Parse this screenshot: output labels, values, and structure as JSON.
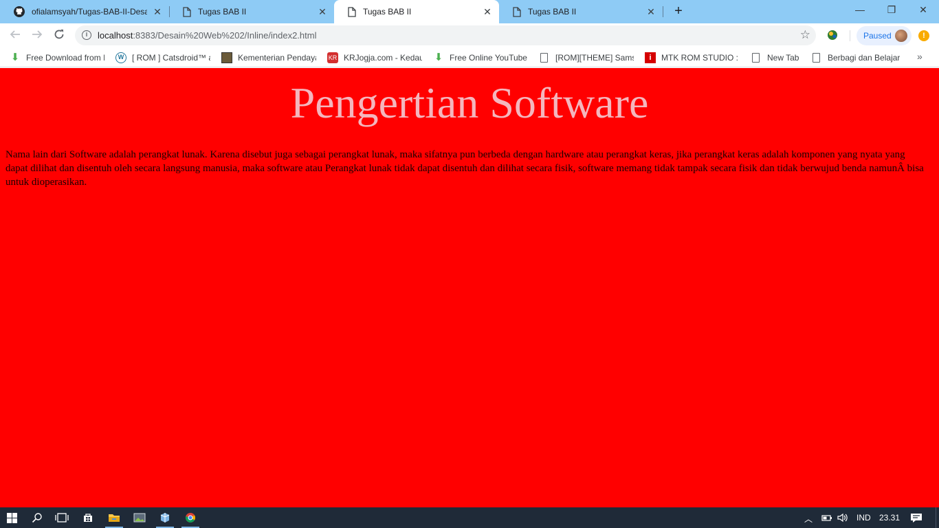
{
  "browser": {
    "tabs": [
      {
        "title": "ofialamsyah/Tugas-BAB-II-Desain",
        "icon": "github-icon",
        "active": false
      },
      {
        "title": "Tugas BAB II",
        "icon": "page-icon",
        "active": false
      },
      {
        "title": "Tugas BAB II",
        "icon": "page-icon",
        "active": true
      },
      {
        "title": "Tugas BAB II",
        "icon": "page-icon",
        "active": false
      }
    ],
    "new_tab_glyph": "+",
    "window_controls": {
      "minimize": "—",
      "restore": "❐",
      "close": "✕"
    },
    "address": {
      "host": "localhost",
      "path": ":8383/Desain%20Web%202/Inline/index2.html"
    },
    "profile": {
      "status": "Paused"
    },
    "bookmarks": [
      {
        "label": "Free Download from I",
        "icon": "download-icon"
      },
      {
        "label": "[ ROM ] Catsdroid™ a",
        "icon": "wordpress-icon"
      },
      {
        "label": "Kementerian Pendaya",
        "icon": "government-emblem-icon"
      },
      {
        "label": "KRJogja.com - Kedau",
        "icon": "krjogja-icon"
      },
      {
        "label": "Free Online YouTube",
        "icon": "download-icon"
      },
      {
        "label": "[ROM][THEME] Sams",
        "icon": "page-icon"
      },
      {
        "label": "MTK ROM STUDIO : C",
        "icon": "mtk-icon"
      },
      {
        "label": "New Tab",
        "icon": "page-icon"
      },
      {
        "label": "Berbagi dan Belajar",
        "icon": "page-icon"
      }
    ],
    "bookmarks_overflow": "»"
  },
  "page": {
    "heading": "Pengertian Software",
    "paragraph": "Nama lain dari Software adalah perangkat lunak. Karena disebut juga sebagai perangkat lunak, maka sifatnya pun berbeda dengan hardware atau perangkat keras, jika perangkat keras adalah komponen yang nyata yang dapat dilihat dan disentuh oleh secara langsung manusia, maka software atau Perangkat lunak tidak dapat disentuh dan dilihat secara fisik, software memang tidak tampak secara fisik dan tidak berwujud benda namunÂ bisa untuk dioperasikan.",
    "background_color": "#ff0000",
    "heading_color": "#f4b6bd"
  },
  "taskbar": {
    "language": "IND",
    "time": "23.31",
    "pinned": [
      "start-icon",
      "search-icon",
      "task-view-icon",
      "store-icon",
      "file-explorer-icon",
      "photo-app-icon",
      "virtualbox-icon",
      "chrome-icon"
    ]
  }
}
